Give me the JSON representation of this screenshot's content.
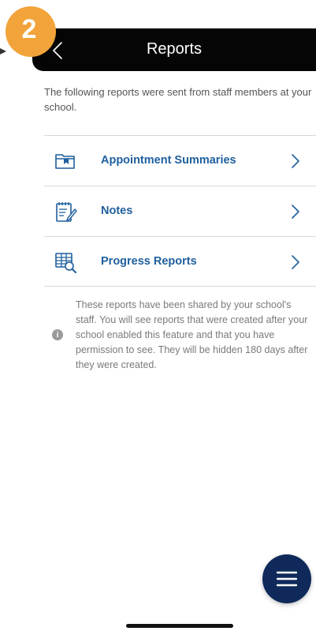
{
  "step_badge": {
    "number": "2",
    "color": "#F2A43A"
  },
  "header": {
    "title": "Reports",
    "back_icon": "chevron-left-icon",
    "background": "#050505"
  },
  "intro_text": "The following reports were sent from staff members at your school.",
  "reports": [
    {
      "label": "Appointment Summaries",
      "icon": "folder-bookmark-icon",
      "chevron": "chevron-right-icon"
    },
    {
      "label": "Notes",
      "icon": "notepad-pencil-icon",
      "chevron": "chevron-right-icon"
    },
    {
      "label": "Progress Reports",
      "icon": "report-magnifier-icon",
      "chevron": "chevron-right-icon"
    }
  ],
  "info": {
    "icon": "info-icon",
    "glyph": "i",
    "text": "These reports have been shared by your school's staff. You will see reports that were created after your school enabled this feature and that you have permission to see. They will be hidden 180 days after they were created."
  },
  "fab": {
    "icon": "hamburger-menu-icon",
    "color": "#0f2a5a"
  },
  "accent_color": "#1f5f9e"
}
